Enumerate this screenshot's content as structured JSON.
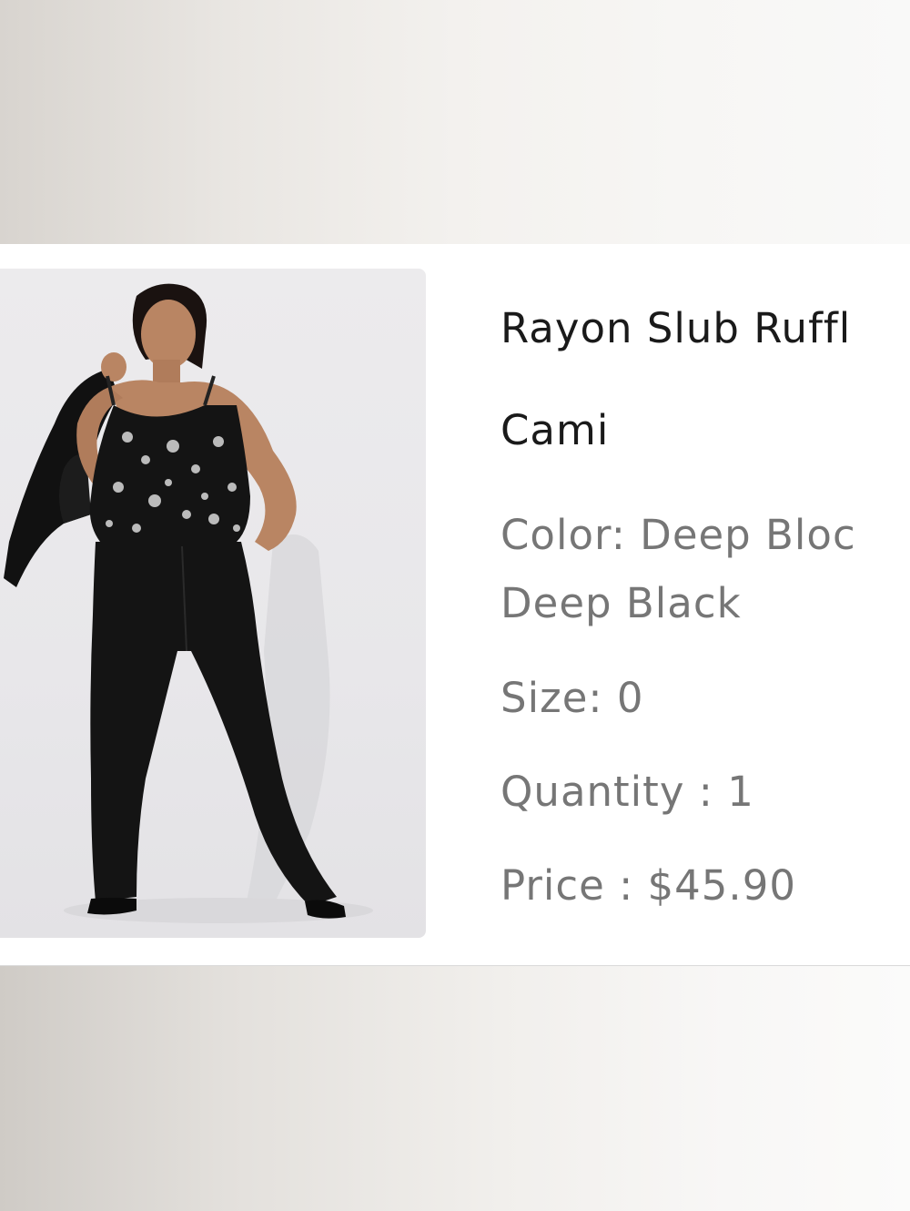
{
  "product": {
    "title_line1": "Rayon Slub Ruffl",
    "title_line2": "Cami",
    "color_line1": "Color: Deep Bloc",
    "color_line2": "Deep Black",
    "size": "Size: 0",
    "quantity": "Quantity : 1",
    "price": "Price : $45.90",
    "image": "model wearing floral black cami, black flare jeans, black jacket over shoulder"
  }
}
